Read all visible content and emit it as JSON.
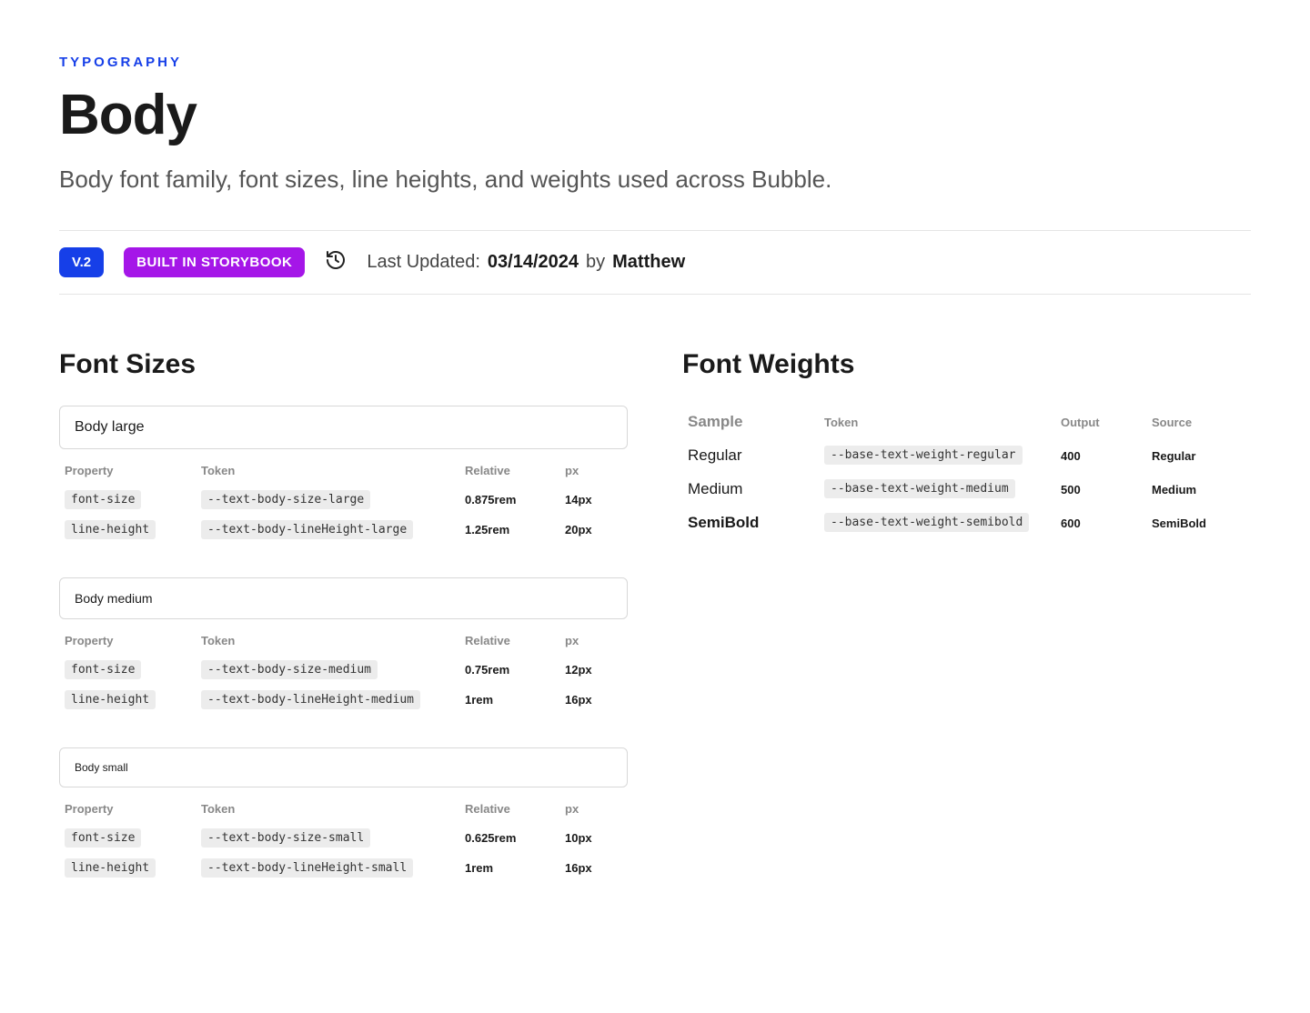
{
  "eyebrow": "TYPOGRAPHY",
  "title": "Body",
  "description": "Body font family, font sizes, line heights, and weights used across Bubble.",
  "badges": {
    "version": "V.2",
    "storybook": "BUILT IN STORYBOOK"
  },
  "meta": {
    "lastUpdatedLabel": "Last Updated:",
    "lastUpdatedDate": "03/14/2024",
    "byLabel": "by",
    "author": "Matthew"
  },
  "sections": {
    "fontSizesTitle": "Font Sizes",
    "fontWeightsTitle": "Font Weights"
  },
  "headers": {
    "property": "Property",
    "token": "Token",
    "relative": "Relative",
    "px": "px",
    "sample": "Sample",
    "output": "Output",
    "source": "Source"
  },
  "fontSizes": [
    {
      "sample": "Body large",
      "rows": [
        {
          "property": "font-size",
          "token": "--text-body-size-large",
          "relative": "0.875rem",
          "px": "14px"
        },
        {
          "property": "line-height",
          "token": "--text-body-lineHeight-large",
          "relative": "1.25rem",
          "px": "20px"
        }
      ]
    },
    {
      "sample": "Body medium",
      "rows": [
        {
          "property": "font-size",
          "token": "--text-body-size-medium",
          "relative": "0.75rem",
          "px": "12px"
        },
        {
          "property": "line-height",
          "token": "--text-body-lineHeight-medium",
          "relative": "1rem",
          "px": "16px"
        }
      ]
    },
    {
      "sample": "Body small",
      "rows": [
        {
          "property": "font-size",
          "token": "--text-body-size-small",
          "relative": "0.625rem",
          "px": "10px"
        },
        {
          "property": "line-height",
          "token": "--text-body-lineHeight-small",
          "relative": "1rem",
          "px": "16px"
        }
      ]
    }
  ],
  "fontWeights": [
    {
      "sample": "Regular",
      "token": "--base-text-weight-regular",
      "output": "400",
      "source": "Regular",
      "fwClass": "fw-regular"
    },
    {
      "sample": "Medium",
      "token": "--base-text-weight-medium",
      "output": "500",
      "source": "Medium",
      "fwClass": "fw-medium"
    },
    {
      "sample": "SemiBold",
      "token": "--base-text-weight-semibold",
      "output": "600",
      "source": "SemiBold",
      "fwClass": "fw-semibold"
    }
  ]
}
